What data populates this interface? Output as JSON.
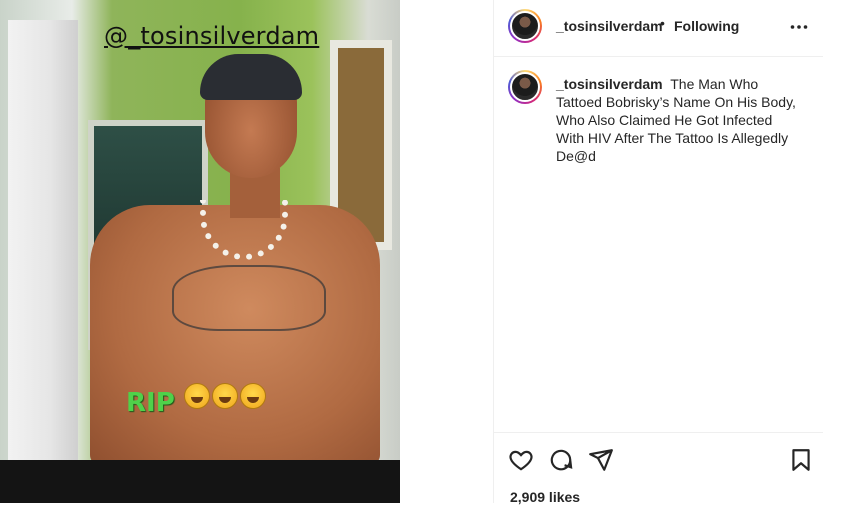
{
  "post": {
    "image": {
      "overlay_handle": "@_tosinsilverdam",
      "overlay_text": "RIP"
    },
    "header": {
      "username": "_tosinsilverdam",
      "separator": "•",
      "follow_status": "Following",
      "more_icon": "more-horizontal-icon"
    },
    "caption": {
      "username": "_tosinsilverdam",
      "text": "The Man Who Tattoed Bobrisky’s Name On His Body, Who Also Claimed He Got Infected With HIV After The Tattoo Is Allegedly De@d"
    },
    "actions": {
      "like_icon": "heart-icon",
      "comment_icon": "comment-icon",
      "share_icon": "send-icon",
      "save_icon": "bookmark-icon"
    },
    "likes": "2,909 likes"
  }
}
